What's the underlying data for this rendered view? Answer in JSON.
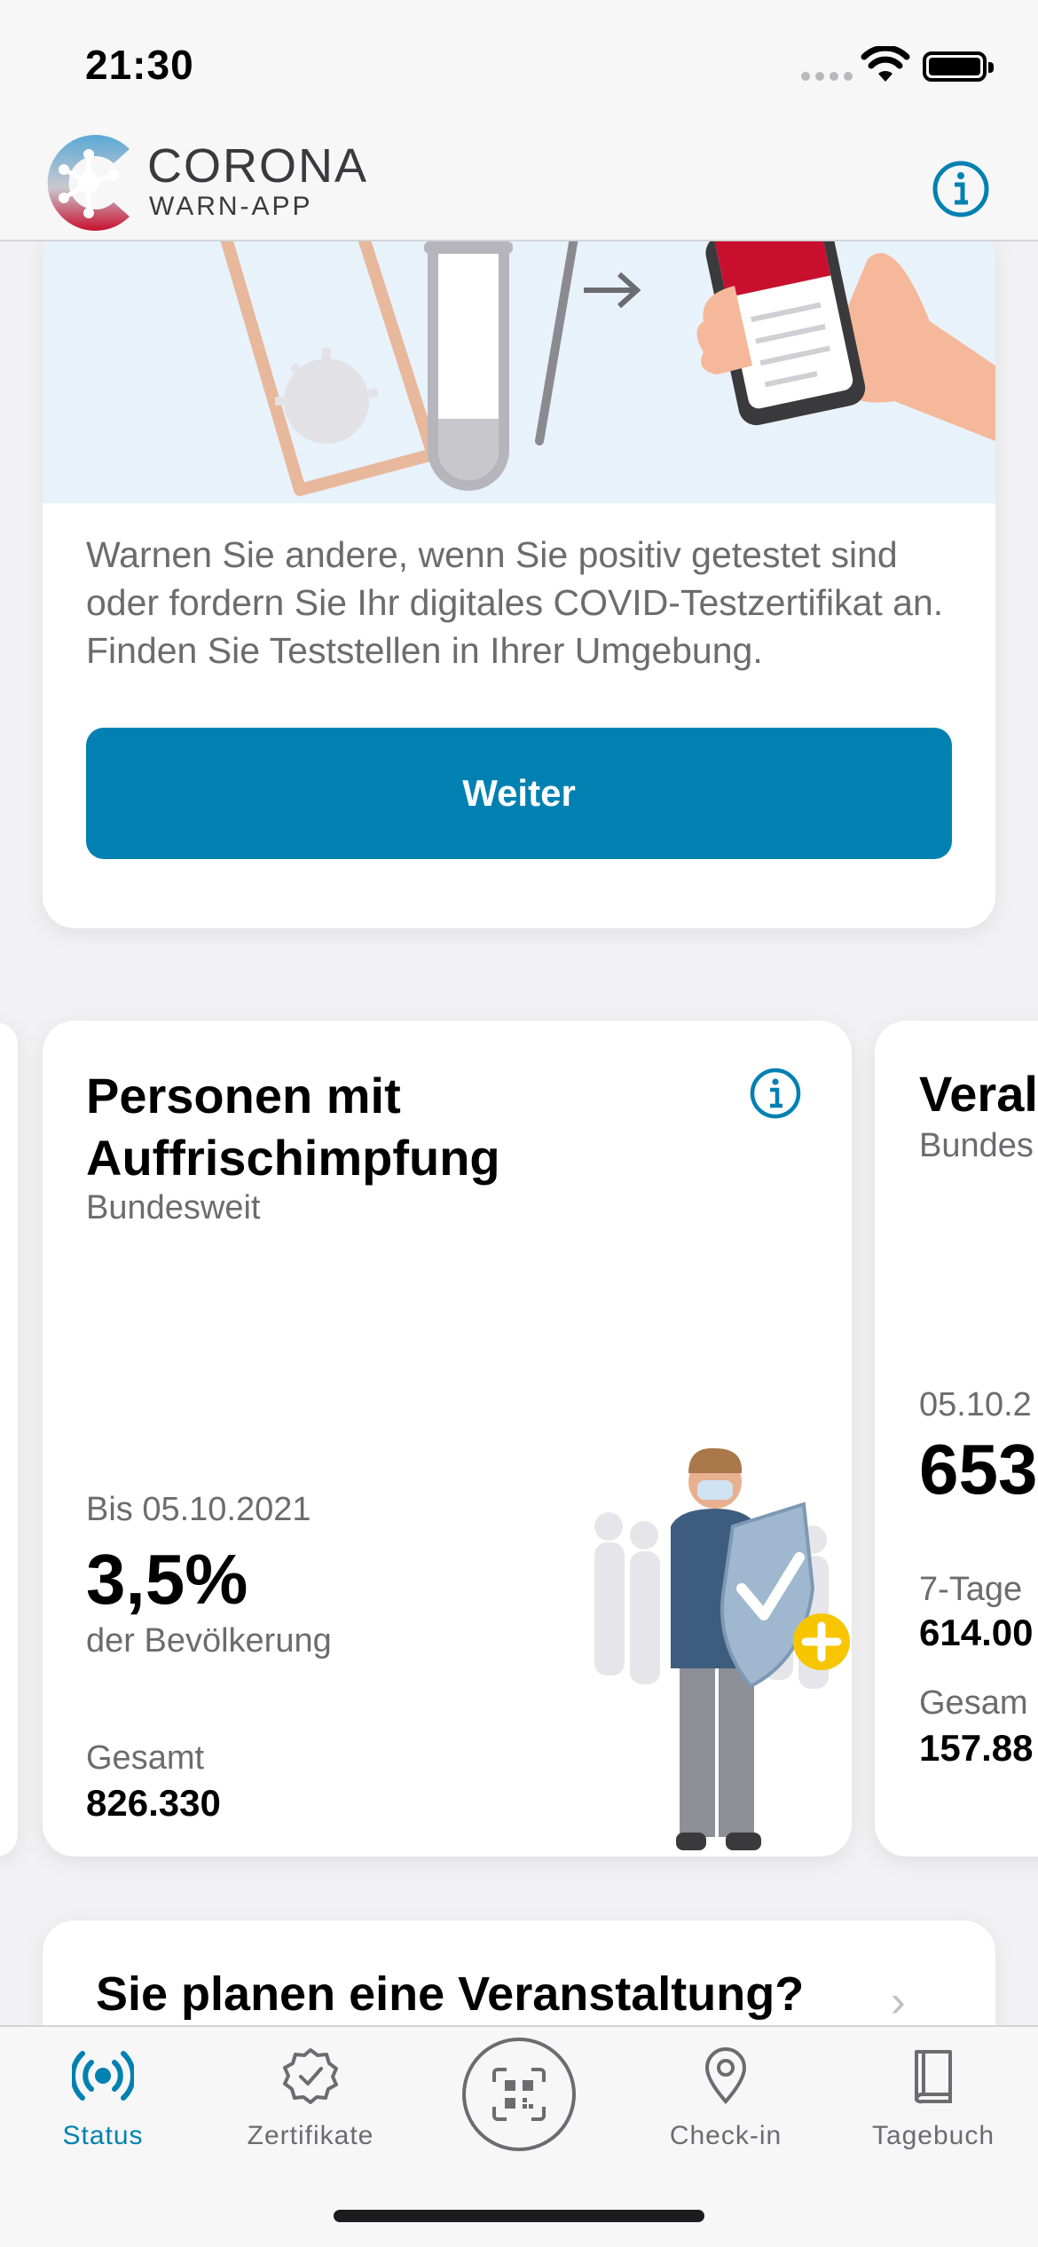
{
  "status_bar": {
    "time": "21:30"
  },
  "header": {
    "logo_line1": "CORONA",
    "logo_line2": "WARN-APP",
    "brand_blue": "#0181b1",
    "brand_red": "#c8102e"
  },
  "test_card": {
    "description": "Warnen Sie andere, wenn Sie positiv getestet sind oder fordern Sie Ihr digitales COVID-Testzertifikat an. Finden Sie Teststellen in Ihrer Umgebung.",
    "button_label": "Weiter"
  },
  "booster_card": {
    "title": "Personen mit Auffrischimpfung",
    "subtitle": "Bundesweit",
    "as_of": "Bis 05.10.2021",
    "value": "3,5%",
    "value_caption": "der Bevölkerung",
    "total_label": "Gesamt",
    "total_value": "826.330"
  },
  "next_card": {
    "title": "Veral",
    "subtitle": "Bundes",
    "date": "05.10.2",
    "value": "653",
    "label1": "7-Tage",
    "value1": "614.00",
    "label2": "Gesam",
    "value2": "157.88"
  },
  "event_card": {
    "title": "Sie planen eine Veranstaltung?",
    "chevron": "›"
  },
  "tab_bar": {
    "tabs": [
      {
        "label": "Status",
        "icon": "broadcast-icon",
        "active": true
      },
      {
        "label": "Zertifikate",
        "icon": "certificate-badge-icon"
      },
      {
        "label": "",
        "icon": "qr-scan-icon"
      },
      {
        "label": "Check-in",
        "icon": "location-pin-icon"
      },
      {
        "label": "Tagebuch",
        "icon": "diary-book-icon"
      }
    ]
  }
}
